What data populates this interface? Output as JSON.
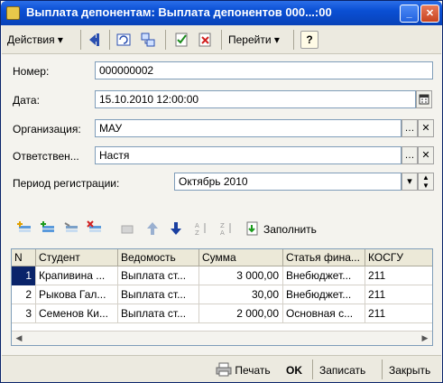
{
  "window": {
    "title": "Выплата депонентам: Выплата депонентов 000...:00"
  },
  "toolbar": {
    "actions_label": "Действия",
    "goto_label": "Перейти",
    "help_label": "?"
  },
  "form": {
    "number_label": "Номер:",
    "number_value": "000000002",
    "date_label": "Дата:",
    "date_value": "15.10.2010 12:00:00",
    "org_label": "Организация:",
    "org_value": "МАУ",
    "resp_label": "Ответствен...",
    "resp_value": "Настя",
    "period_label": "Период регистрации:",
    "period_value": "Октябрь 2010"
  },
  "tabletoolbar": {
    "fill_label": "Заполнить"
  },
  "table": {
    "columns": [
      "N",
      "Студент",
      "Ведомость",
      "Сумма",
      "Статья фина...",
      "КОСГУ"
    ],
    "rows": [
      {
        "n": "1",
        "student": "Крапивина ...",
        "statement": "Выплата ст...",
        "sum": "3 000,00",
        "article": "Внебюджет...",
        "kosgu": "211"
      },
      {
        "n": "2",
        "student": "Рыкова Гал...",
        "statement": "Выплата ст...",
        "sum": "30,00",
        "article": "Внебюджет...",
        "kosgu": "211"
      },
      {
        "n": "3",
        "student": "Семенов Ки...",
        "statement": "Выплата ст...",
        "sum": "2 000,00",
        "article": "Основная с...",
        "kosgu": "211"
      }
    ]
  },
  "footer": {
    "print_label": "Печать",
    "ok_label": "OK",
    "save_label": "Записать",
    "close_label": "Закрыть"
  },
  "colors": {
    "title_bar": "#0a4fd4",
    "selection": "#0a246a",
    "window_bg": "#f4f3ee"
  },
  "icons": [
    "app-icon",
    "minimize-icon",
    "close-icon",
    "back-icon",
    "refresh-icon",
    "structure-icon",
    "post-icon",
    "unpost-icon",
    "calendar-icon",
    "ellipsis-icon",
    "clear-icon",
    "dropdown-icon",
    "spin-icon",
    "add-row-icon",
    "copy-row-icon",
    "edit-row-icon",
    "delete-row-icon",
    "end-edit-icon",
    "move-up-icon",
    "move-down-icon",
    "sort-asc-icon",
    "sort-desc-icon",
    "fill-icon",
    "print-icon"
  ]
}
